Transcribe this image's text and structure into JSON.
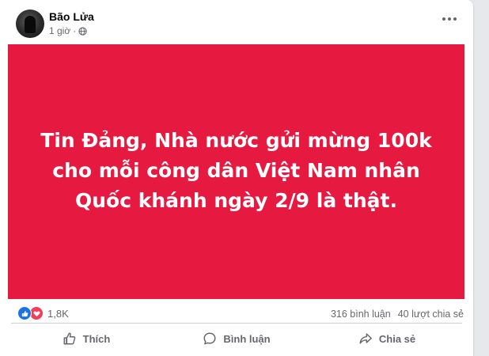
{
  "post": {
    "author": "Bão Lửa",
    "time": "1 giờ",
    "separator": "·",
    "banner_text": "Tin Đảng, Nhà nước gửi mừng 100k cho mỗi công dân Việt Nam nhân Quốc khánh ngày 2/9 là thật.",
    "banner_color": "#e61a41"
  },
  "stats": {
    "reaction_count": "1,8K",
    "comments": "316 bình luận",
    "shares": "40 lượt chia sẻ",
    "reaction_icons": [
      "like-icon",
      "love-icon"
    ]
  },
  "actions": {
    "like": "Thích",
    "comment": "Bình luận",
    "share": "Chia sẻ"
  }
}
